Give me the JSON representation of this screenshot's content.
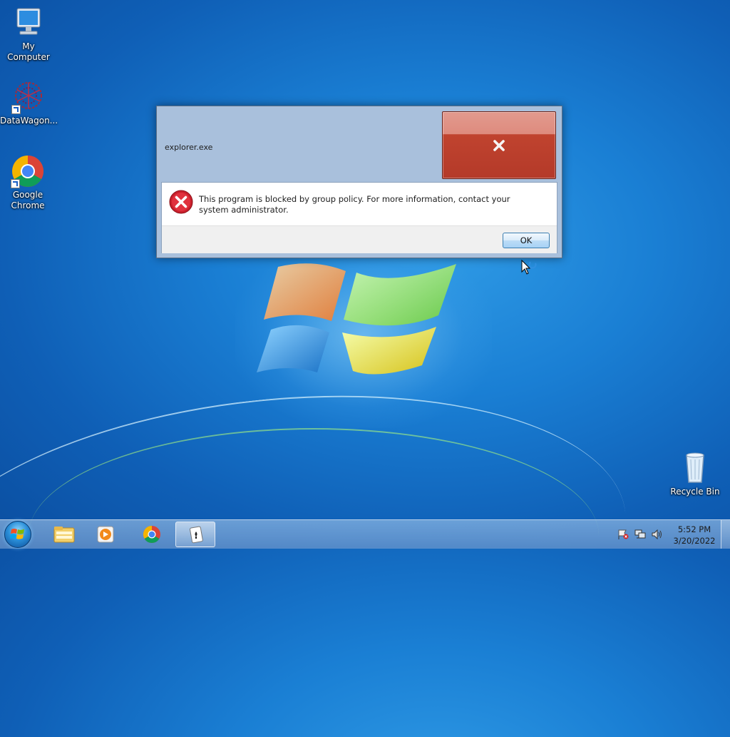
{
  "desktop": {
    "icons": [
      {
        "label": "My Computer"
      },
      {
        "label": "DataWagon..."
      },
      {
        "label": "Google Chrome"
      }
    ],
    "recycle_bin": {
      "label": "Recycle Bin"
    }
  },
  "dialog": {
    "title": "explorer.exe",
    "message": "This program is blocked by group policy. For more information, contact your system administrator.",
    "ok_label": "OK",
    "icon": "error-icon"
  },
  "taskbar": {
    "items": [
      "start-orb",
      "file-explorer-icon",
      "media-player-icon",
      "chrome-icon",
      "solitaire-icon"
    ],
    "clock": {
      "time": "5:52 PM",
      "date": "3/20/2022"
    },
    "tray_icons": [
      "action-center-flag-icon",
      "network-icon",
      "volume-icon"
    ]
  },
  "colors": {
    "dialog_frame": "#a9c0dc",
    "close_red": "#c0432f",
    "desktop_blue": "#1a7fd4"
  }
}
